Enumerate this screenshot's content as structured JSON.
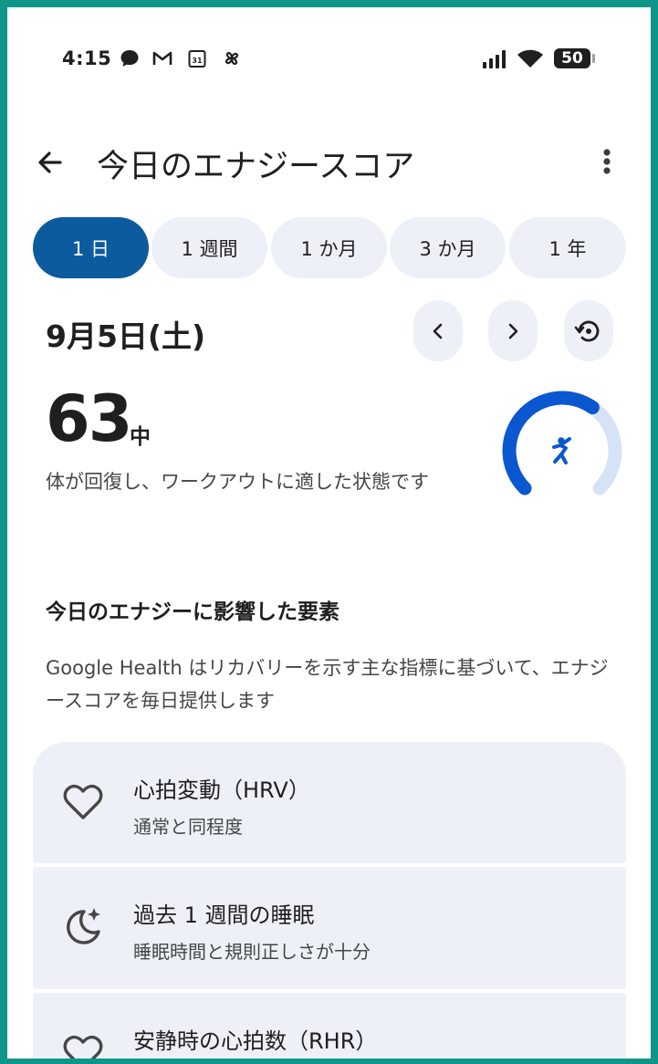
{
  "status_bar": {
    "time": "4:15",
    "battery": "50",
    "left_icons": [
      "chat-icon",
      "gmail-icon",
      "calendar-icon",
      "pinwheel-icon"
    ],
    "right_icons": [
      "signal-icon",
      "wifi-icon",
      "battery-icon"
    ]
  },
  "header": {
    "title": "今日のエナジースコア"
  },
  "tabs": [
    {
      "label": "1 日",
      "active": true
    },
    {
      "label": "1 週間",
      "active": false
    },
    {
      "label": "1 か月",
      "active": false
    },
    {
      "label": "3 か月",
      "active": false
    },
    {
      "label": "1 年",
      "active": false
    }
  ],
  "date_row": {
    "date": "9月5日(土)"
  },
  "score": {
    "value": "63",
    "level": "中",
    "description": "体が回復し、ワークアウトに適した状態です",
    "fill_fraction": 0.63,
    "accent_color": "#0b57d0",
    "track_color": "#d6e3f7"
  },
  "factors": {
    "title": "今日のエナジーに影響した要素",
    "description": "Google Health はリカバリーを示す主な指標に基づいて、エナジースコアを毎日提供します",
    "items": [
      {
        "icon": "heart-icon",
        "title": "心拍変動（HRV）",
        "subtitle": "通常と同程度"
      },
      {
        "icon": "moon-sparkle-icon",
        "title": "過去 1 週間の睡眠",
        "subtitle": "睡眠時間と規則正しさが十分"
      },
      {
        "icon": "heart-icon",
        "title": "安静時の心拍数（RHR）",
        "subtitle": ""
      }
    ]
  }
}
